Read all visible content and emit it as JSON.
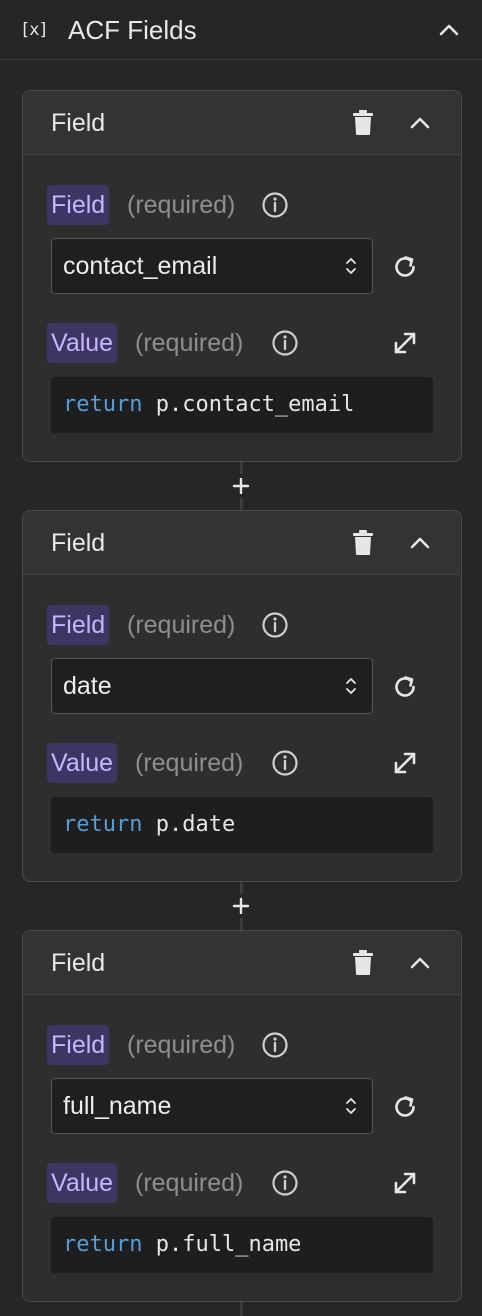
{
  "panel": {
    "icon": "[x]",
    "title": "ACF Fields"
  },
  "cards": [
    {
      "title": "Field",
      "field_label": "Field",
      "field_required": "(required)",
      "field_value": "contact_email",
      "value_label": "Value",
      "value_required": "(required)",
      "code_keyword": "return",
      "code_expr": "p.contact_email"
    },
    {
      "title": "Field",
      "field_label": "Field",
      "field_required": "(required)",
      "field_value": "date",
      "value_label": "Value",
      "value_required": "(required)",
      "code_keyword": "return",
      "code_expr": "p.date"
    },
    {
      "title": "Field",
      "field_label": "Field",
      "field_required": "(required)",
      "field_value": "full_name",
      "value_label": "Value",
      "value_required": "(required)",
      "code_keyword": "return",
      "code_expr": "p.full_name"
    }
  ],
  "add_button_symbol": "+",
  "icons": {
    "header": "variable-icon",
    "collapse": "chevron-up-icon",
    "delete": "trash-icon",
    "info": "info-icon",
    "select": "select-arrows-icon",
    "refresh": "refresh-icon",
    "expand": "expand-icon",
    "add": "plus-icon"
  },
  "colors": {
    "background": "#262626",
    "card": "#2e2e2e",
    "badge_bg": "#3f3563",
    "badge_text": "#c5b6ff",
    "keyword": "#569cd6"
  }
}
